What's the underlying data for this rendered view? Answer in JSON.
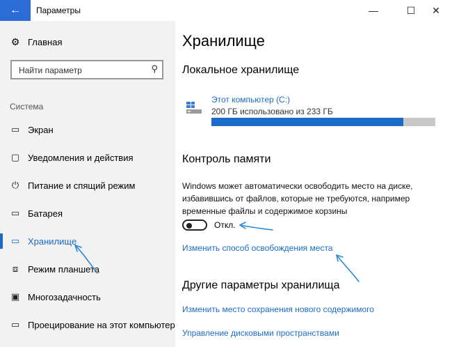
{
  "window": {
    "title": "Параметры",
    "back_icon": "←",
    "minimize_icon": "—",
    "maximize_icon": "☐",
    "close_icon": "✕"
  },
  "sidebar": {
    "home_label": "Главная",
    "home_icon": "⚙",
    "search_placeholder": "Найти параметр",
    "search_icon": "⚲",
    "section_title": "Система",
    "items": [
      {
        "label": "Экран",
        "icon": "▭"
      },
      {
        "label": "Уведомления и действия",
        "icon": "▢"
      },
      {
        "label": "Питание и спящий режим",
        "icon": "⏻"
      },
      {
        "label": "Батарея",
        "icon": "▭"
      },
      {
        "label": "Хранилище",
        "icon": "▭"
      },
      {
        "label": "Режим планшета",
        "icon": "⧈"
      },
      {
        "label": "Многозадачность",
        "icon": "▣"
      },
      {
        "label": "Проецирование на этот компьютер",
        "icon": "▭"
      }
    ],
    "active_item": "Хранилище"
  },
  "main": {
    "title": "Хранилище",
    "local_storage_heading": "Локальное хранилище",
    "drive": {
      "name": "Этот компьютер (C:)",
      "usage": "200 ГБ использовано из 233 ГБ",
      "used_fraction": 0.858
    },
    "memory_control_heading": "Контроль памяти",
    "memory_control_desc": "Windows может автоматически освободить место на диске, избавившись от файлов, которые не требуются, например временные файлы и содержимое корзины",
    "toggle_state": "Откл.",
    "change_link": "Изменить способ освобождения места",
    "other_heading": "Другие параметры хранилища",
    "other_links": [
      "Изменить место сохранения нового содержимого",
      "Управление дисковыми пространствами"
    ]
  },
  "colors": {
    "accent": "#1b6bc7",
    "back_button": "#2b6cd6",
    "sidebar_bg": "#f2f2f2",
    "bar_track": "#c8c8c8",
    "annotation_arrow": "#2a8ad8"
  }
}
